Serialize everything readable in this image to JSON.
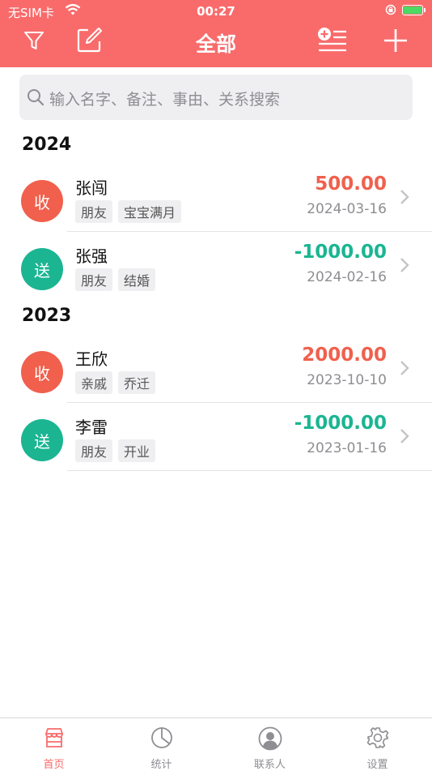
{
  "status_bar": {
    "carrier": "无SIM卡",
    "time": "00:27"
  },
  "header": {
    "title": "全部",
    "icons": [
      "filter-icon",
      "edit-icon",
      "add-list-icon",
      "plus-icon"
    ]
  },
  "search": {
    "placeholder": "输入名字、备注、事由、关系搜索"
  },
  "sections": [
    {
      "year": "2024",
      "records": [
        {
          "type": "收",
          "name": "张闯",
          "tags": [
            "朋友",
            "宝宝满月"
          ],
          "amount": "500.00",
          "date": "2024-03-16"
        },
        {
          "type": "送",
          "name": "张强",
          "tags": [
            "朋友",
            "结婚"
          ],
          "amount": "-1000.00",
          "date": "2024-02-16"
        }
      ]
    },
    {
      "year": "2023",
      "records": [
        {
          "type": "收",
          "name": "王欣",
          "tags": [
            "亲戚",
            "乔迁"
          ],
          "amount": "2000.00",
          "date": "2023-10-10"
        },
        {
          "type": "送",
          "name": "李雷",
          "tags": [
            "朋友",
            "开业"
          ],
          "amount": "-1000.00",
          "date": "2023-01-16"
        }
      ]
    }
  ],
  "tabs": [
    {
      "label": "首页",
      "icon": "home-icon",
      "active": true
    },
    {
      "label": "统计",
      "icon": "pie-chart-icon",
      "active": false
    },
    {
      "label": "联系人",
      "icon": "contacts-icon",
      "active": false
    },
    {
      "label": "设置",
      "icon": "settings-icon",
      "active": false
    }
  ],
  "colors": {
    "accent": "#f96b6b",
    "receive": "#f0604d",
    "send": "#1bb592"
  }
}
